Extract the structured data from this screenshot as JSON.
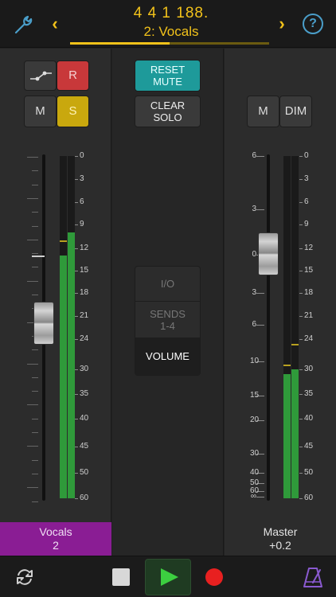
{
  "topbar": {
    "position": "4  4  1  188.",
    "track_name": "2: Vocals",
    "nav_left_glyph": "‹",
    "nav_right_glyph": "›",
    "help_glyph": "?",
    "progress_fraction": 0.5,
    "icons": {
      "settings": "wrench-icon",
      "help": "question-circle-icon"
    }
  },
  "vocals_strip": {
    "automation_icon": "automation-curve-icon",
    "record_label": "R",
    "mute_label": "M",
    "solo_label": "S",
    "name": "Vocals",
    "number": "2",
    "fader_db": -22,
    "meter_left_db": -13,
    "meter_right_db": -10,
    "peak_left_db": -11,
    "colors": {
      "record": "#c8383a",
      "solo": "#c9a80e",
      "plate": "#8a1d94",
      "meter": "#2f9a3a"
    }
  },
  "middle": {
    "reset_mute": [
      "RESET",
      "MUTE"
    ],
    "clear_solo": [
      "CLEAR",
      "SOLO"
    ],
    "views": [
      {
        "label": "I/O",
        "selected": false
      },
      {
        "label": "SENDS",
        "sub": "1-4",
        "selected": false
      },
      {
        "label": "VOLUME",
        "selected": true
      }
    ],
    "colors": {
      "reset_mute": "#1e9a9a"
    }
  },
  "master_strip": {
    "mute_label": "M",
    "dim_label": "DIM",
    "name": "Master",
    "value": "+0.2",
    "fader_db": 0.2,
    "meter_left_db": -31,
    "meter_right_db": -30,
    "peak_left_db": -29,
    "peak_right_db": -25
  },
  "meter_scale": [
    "0",
    "3",
    "6",
    "9",
    "12",
    "15",
    "18",
    "21",
    "24",
    "30",
    "35",
    "40",
    "45",
    "50",
    "60"
  ],
  "vocals_fader_scale": [],
  "master_fader_scale": [
    "6",
    "3",
    "0",
    "3",
    "6",
    "10",
    "15",
    "20",
    "30",
    "40",
    "50",
    "60",
    "∞"
  ],
  "transport": {
    "icons": {
      "cycle": "cycle-icon",
      "stop": "stop-icon",
      "play": "play-icon",
      "record": "record-icon",
      "metronome": "metronome-icon"
    },
    "colors": {
      "play": "#3ccf40",
      "record": "#e82020"
    }
  }
}
